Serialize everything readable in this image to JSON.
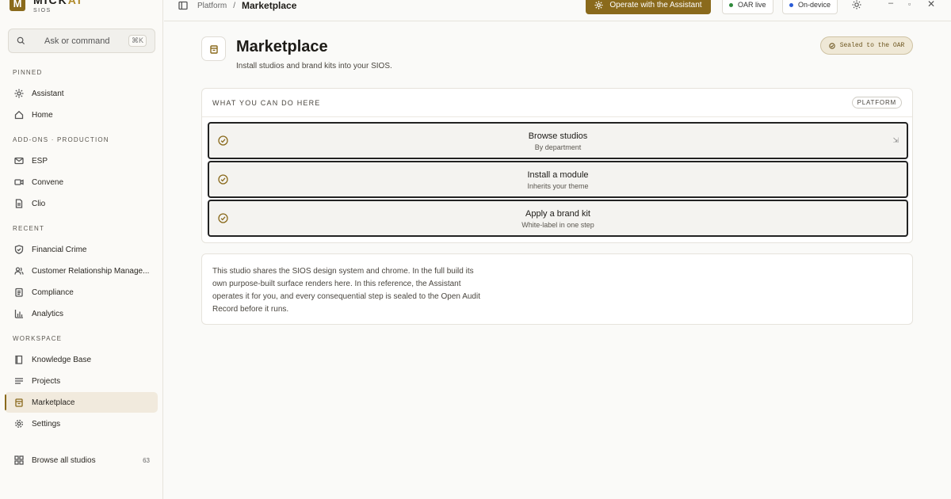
{
  "brand": {
    "logo_letter": "M",
    "name_main": "MICK",
    "name_accent": "AI",
    "subtitle": "SIOS"
  },
  "search": {
    "placeholder": "Ask or command",
    "shortcut": "⌘K"
  },
  "sidebar": {
    "sections": [
      {
        "label": "PINNED",
        "items": [
          {
            "label": "Assistant",
            "icon": "sparkle-icon"
          },
          {
            "label": "Home",
            "icon": "home-icon"
          }
        ]
      },
      {
        "label": "ADD-ONS · PRODUCTION",
        "items": [
          {
            "label": "ESP",
            "icon": "mail-icon"
          },
          {
            "label": "Convene",
            "icon": "video-icon"
          },
          {
            "label": "Clio",
            "icon": "document-icon"
          }
        ]
      },
      {
        "label": "RECENT",
        "items": [
          {
            "label": "Financial Crime",
            "icon": "shield-icon"
          },
          {
            "label": "Customer Relationship Manage...",
            "icon": "users-icon"
          },
          {
            "label": "Compliance",
            "icon": "clipboard-icon"
          },
          {
            "label": "Analytics",
            "icon": "bar-chart-icon"
          }
        ]
      },
      {
        "label": "WORKSPACE",
        "items": [
          {
            "label": "Knowledge Base",
            "icon": "book-icon"
          },
          {
            "label": "Projects",
            "icon": "list-icon"
          },
          {
            "label": "Marketplace",
            "icon": "store-icon",
            "active": true
          },
          {
            "label": "Settings",
            "icon": "gear-icon"
          }
        ]
      }
    ],
    "browse": {
      "label": "Browse all studios",
      "count": "63"
    }
  },
  "topbar": {
    "breadcrumb_parent": "Platform",
    "breadcrumb_sep": "/",
    "breadcrumb_current": "Marketplace",
    "assistant_button": "Operate with the Assistant",
    "oar_status": "OAR live",
    "device_status": "On-device"
  },
  "page": {
    "title": "Marketplace",
    "subtitle": "Install studios and brand kits into your SIOS.",
    "sealed_badge": "Sealed to the OAR"
  },
  "capabilities": {
    "header": "WHAT YOU CAN DO HERE",
    "tag": "PLATFORM",
    "actions": [
      {
        "title": "Browse studios",
        "subtitle": "By department"
      },
      {
        "title": "Install a module",
        "subtitle": "Inherits your theme"
      },
      {
        "title": "Apply a brand kit",
        "subtitle": "White-label in one step"
      }
    ]
  },
  "note": "This studio shares the SIOS design system and chrome. In the full build its own purpose-built surface renders here. In this reference, the Assistant operates it for you, and every consequential step is sealed to the Open Audit Record before it runs.",
  "colors": {
    "accent": "#8a6a1c",
    "oar_dot": "#2f8a3c",
    "device_dot": "#2a5bd7"
  }
}
